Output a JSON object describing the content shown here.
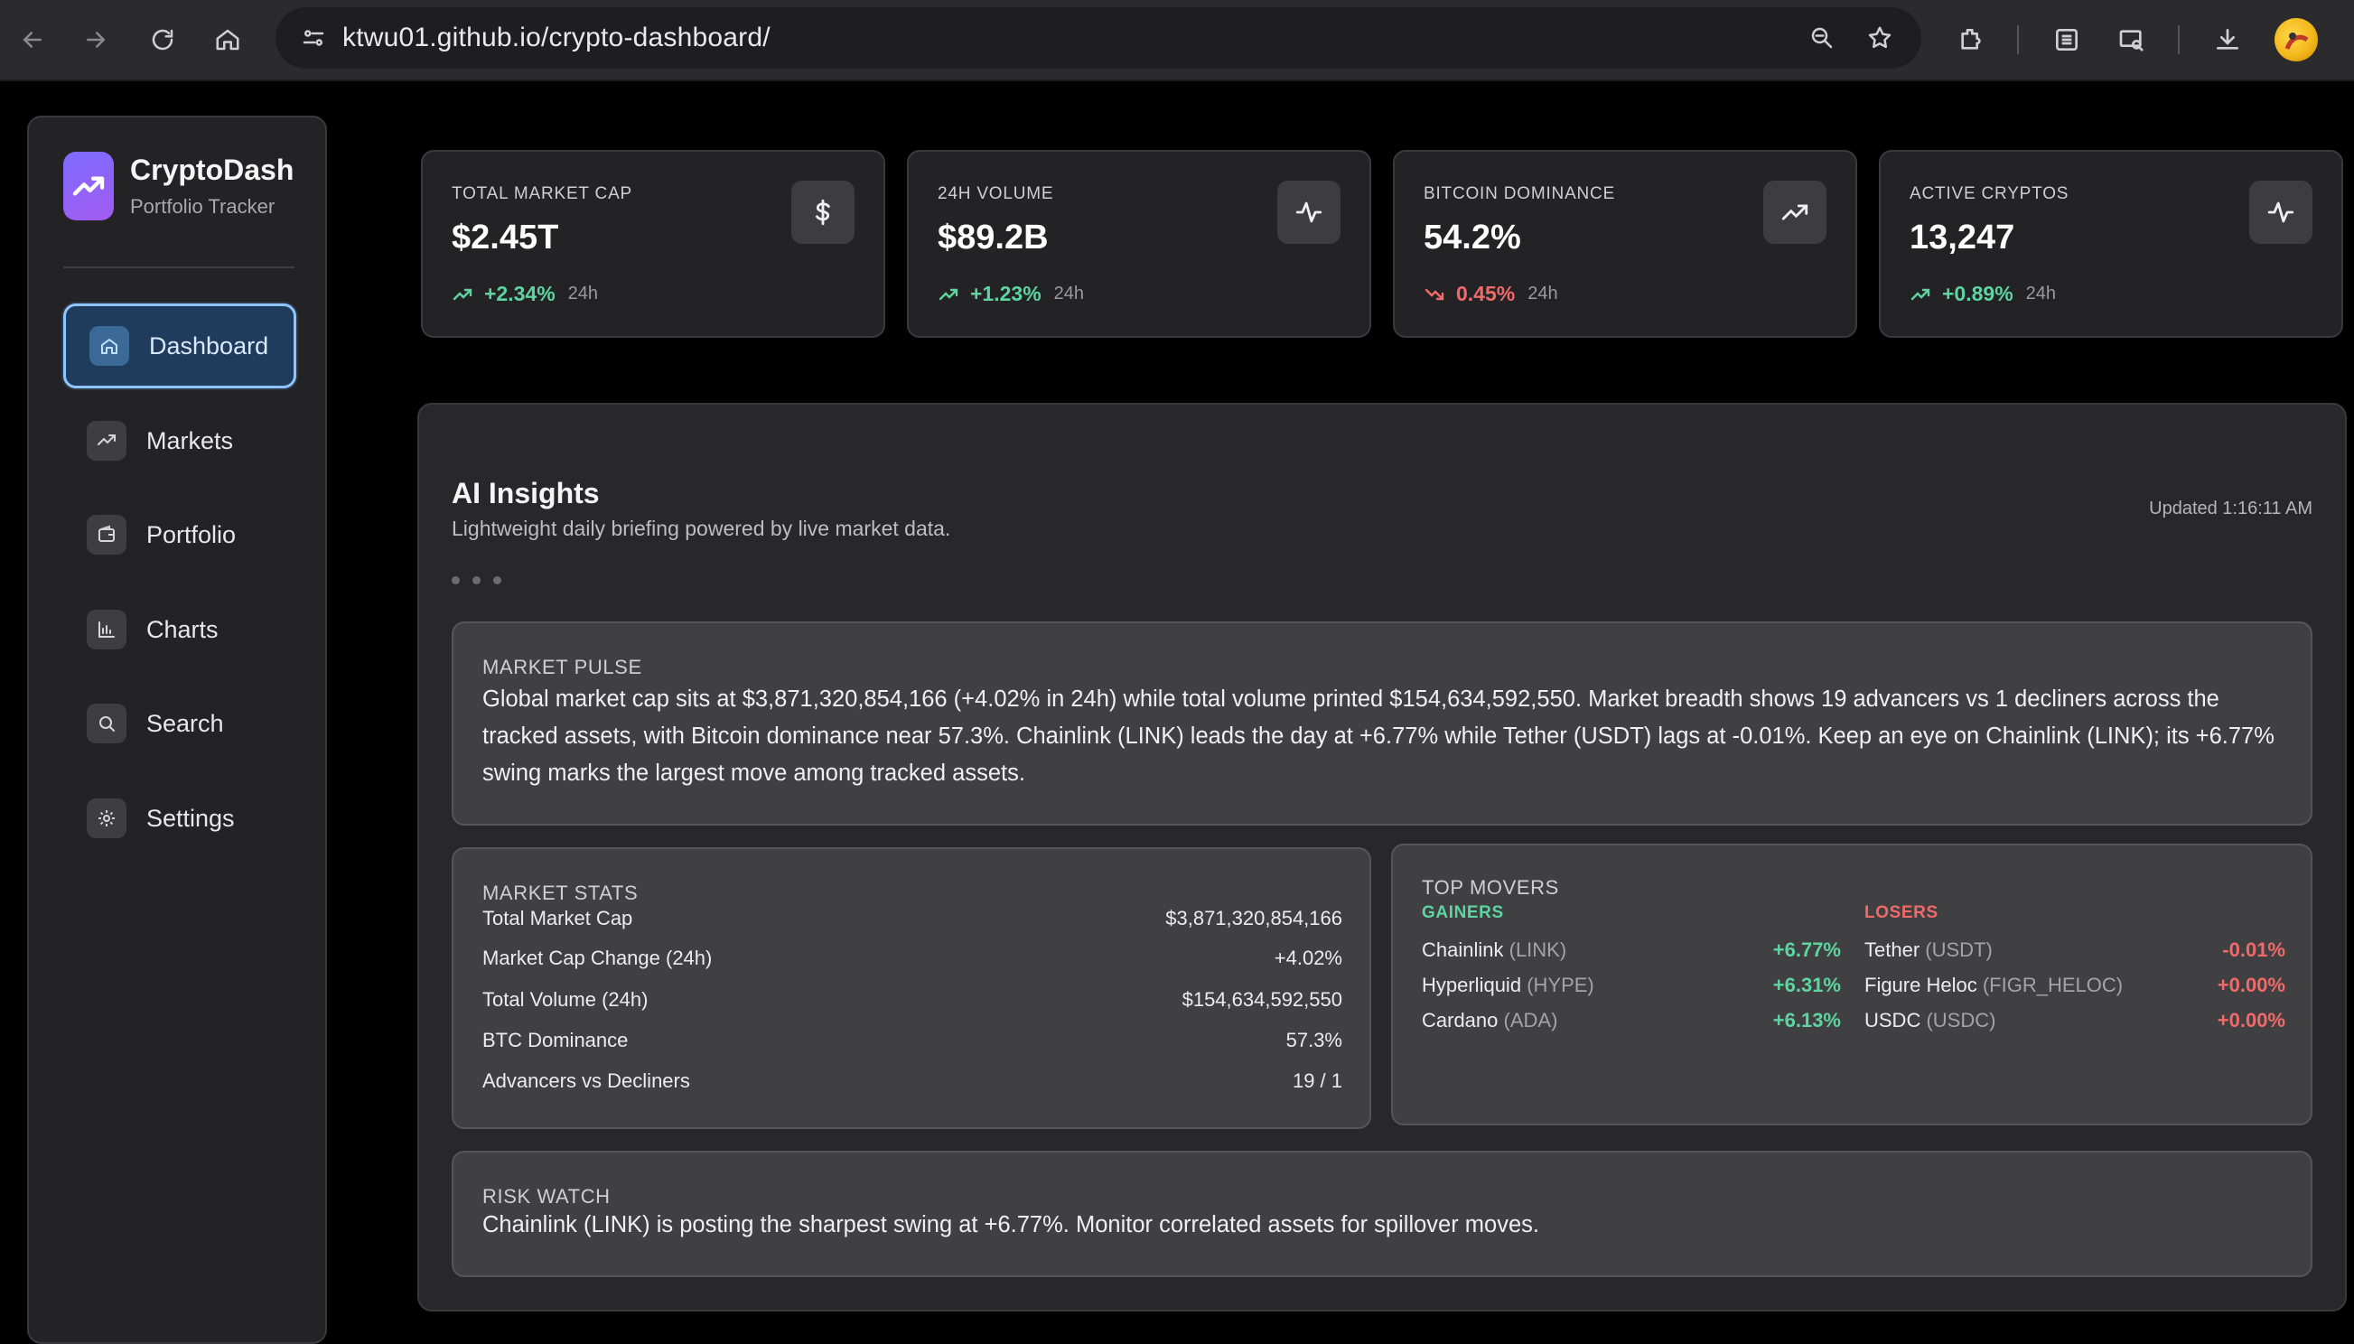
{
  "browser": {
    "url": "ktwu01.github.io/crypto-dashboard/"
  },
  "sidebar": {
    "brand_title": "CryptoDash",
    "brand_subtitle": "Portfolio Tracker",
    "items": [
      {
        "label": "Dashboard",
        "icon": "home-icon",
        "active": true
      },
      {
        "label": "Markets",
        "icon": "trending-up-icon"
      },
      {
        "label": "Portfolio",
        "icon": "wallet-icon"
      },
      {
        "label": "Charts",
        "icon": "bar-chart-icon"
      },
      {
        "label": "Search",
        "icon": "search-icon"
      },
      {
        "label": "Settings",
        "icon": "gear-icon"
      }
    ]
  },
  "stats": [
    {
      "label": "TOTAL MARKET CAP",
      "value": "$2.45T",
      "change": "+2.34%",
      "period": "24h",
      "direction": "up",
      "icon": "dollar-icon"
    },
    {
      "label": "24H VOLUME",
      "value": "$89.2B",
      "change": "+1.23%",
      "period": "24h",
      "direction": "up",
      "icon": "activity-icon"
    },
    {
      "label": "BITCOIN DOMINANCE",
      "value": "54.2%",
      "change": "0.45%",
      "period": "24h",
      "direction": "down",
      "icon": "trending-up-icon"
    },
    {
      "label": "ACTIVE CRYPTOS",
      "value": "13,247",
      "change": "+0.89%",
      "period": "24h",
      "direction": "up",
      "icon": "activity-icon"
    }
  ],
  "insights": {
    "title": "AI Insights",
    "subtitle": "Lightweight daily briefing powered by live market data.",
    "updated": "Updated 1:16:11 AM",
    "pulse": {
      "heading": "MARKET PULSE",
      "text": "Global market cap sits at $3,871,320,854,166 (+4.02% in 24h) while total volume printed $154,634,592,550. Market breadth shows 19 advancers vs 1 decliners across the tracked assets, with Bitcoin dominance near 57.3%. Chainlink (LINK) leads the day at +6.77% while Tether (USDT) lags at -0.01%. Keep an eye on Chainlink (LINK); its +6.77% swing marks the largest move among tracked assets."
    },
    "market_stats": {
      "heading": "MARKET STATS",
      "rows": [
        {
          "label": "Total Market Cap",
          "value": "$3,871,320,854,166"
        },
        {
          "label": "Market Cap Change (24h)",
          "value": "+4.02%"
        },
        {
          "label": "Total Volume (24h)",
          "value": "$154,634,592,550"
        },
        {
          "label": "BTC Dominance",
          "value": "57.3%"
        },
        {
          "label": "Advancers vs Decliners",
          "value": "19 / 1"
        }
      ]
    },
    "top_movers": {
      "heading": "TOP MOVERS",
      "gainers_label": "GAINERS",
      "losers_label": "LOSERS",
      "gainers": [
        {
          "name": "Chainlink",
          "symbol": "(LINK)",
          "change": "+6.77%"
        },
        {
          "name": "Hyperliquid",
          "symbol": "(HYPE)",
          "change": "+6.31%"
        },
        {
          "name": "Cardano",
          "symbol": "(ADA)",
          "change": "+6.13%"
        }
      ],
      "losers": [
        {
          "name": "Tether",
          "symbol": "(USDT)",
          "change": "-0.01%"
        },
        {
          "name": "Figure Heloc",
          "symbol": "(FIGR_HELOC)",
          "change": "+0.00%"
        },
        {
          "name": "USDC",
          "symbol": "(USDC)",
          "change": "+0.00%"
        }
      ]
    },
    "risk": {
      "heading": "RISK WATCH",
      "text": "Chainlink (LINK) is posting the sharpest swing at +6.77%. Monitor correlated assets for spillover moves."
    }
  },
  "colors": {
    "positive": "#5ed4a0",
    "negative": "#f06a6a",
    "accent": "#8ec5ff",
    "brand": "#8a63f5"
  }
}
